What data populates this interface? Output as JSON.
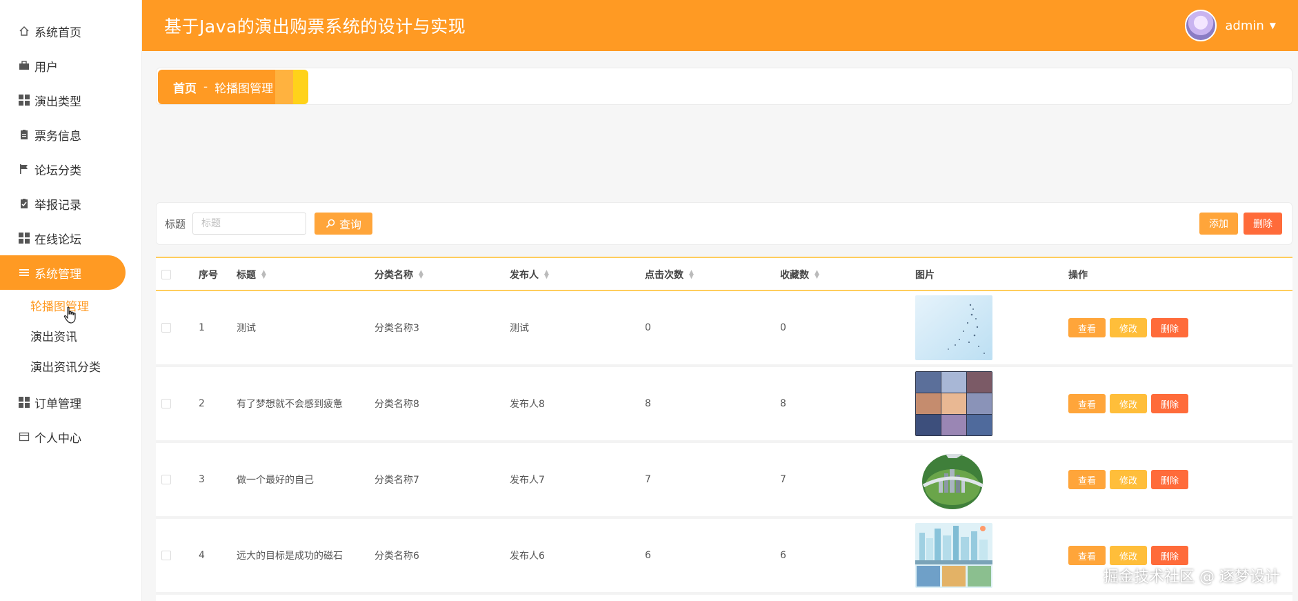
{
  "app": {
    "title": "基于Java的演出购票系统的设计与实现",
    "user": "admin"
  },
  "sidebar": {
    "items": [
      {
        "label": "系统首页",
        "icon": "home-icon"
      },
      {
        "label": "用户",
        "icon": "briefcase-icon"
      },
      {
        "label": "演出类型",
        "icon": "grid-icon"
      },
      {
        "label": "票务信息",
        "icon": "clipboard-icon"
      },
      {
        "label": "论坛分类",
        "icon": "flag-icon"
      },
      {
        "label": "举报记录",
        "icon": "check-clipboard-icon"
      },
      {
        "label": "在线论坛",
        "icon": "grid-icon"
      },
      {
        "label": "系统管理",
        "icon": "menu-icon",
        "active": true
      },
      {
        "label": "订单管理",
        "icon": "grid-icon"
      },
      {
        "label": "个人中心",
        "icon": "card-icon"
      }
    ],
    "submenu": [
      {
        "label": "轮播图管理",
        "active": true
      },
      {
        "label": "演出资讯"
      },
      {
        "label": "演出资讯分类"
      }
    ]
  },
  "breadcrumb": {
    "home": "首页",
    "separator": "-",
    "current": "轮播图管理"
  },
  "search": {
    "label": "标题",
    "placeholder": "标题",
    "query_button": "查询",
    "add_button": "添加",
    "delete_button": "删除"
  },
  "table": {
    "headers": {
      "index": "序号",
      "title": "标题",
      "category": "分类名称",
      "publisher": "发布人",
      "clicks": "点击次数",
      "favorites": "收藏数",
      "image": "图片",
      "actions": "操作"
    },
    "action_labels": {
      "view": "查看",
      "edit": "修改",
      "delete": "删除"
    },
    "rows": [
      {
        "index": "1",
        "title": "测试",
        "category": "分类名称3",
        "publisher": "测试",
        "clicks": "0",
        "favorites": "0",
        "image": "sky-birds"
      },
      {
        "index": "2",
        "title": "有了梦想就不会感到疲惫",
        "category": "分类名称8",
        "publisher": "发布人8",
        "clicks": "8",
        "favorites": "8",
        "image": "photo-grid"
      },
      {
        "index": "3",
        "title": "做一个最好的自己",
        "category": "分类名称7",
        "publisher": "发布人7",
        "clicks": "7",
        "favorites": "7",
        "image": "city-globe"
      },
      {
        "index": "4",
        "title": "远大的目标是成功的磁石",
        "category": "分类名称6",
        "publisher": "发布人6",
        "clicks": "6",
        "favorites": "6",
        "image": "city-illustration"
      }
    ]
  },
  "watermark": "掘金技术社区 @ 逐梦设计",
  "colors": {
    "primary": "#ff9a23",
    "danger": "#ff6b3a",
    "table_accent": "#ffcd5c"
  }
}
